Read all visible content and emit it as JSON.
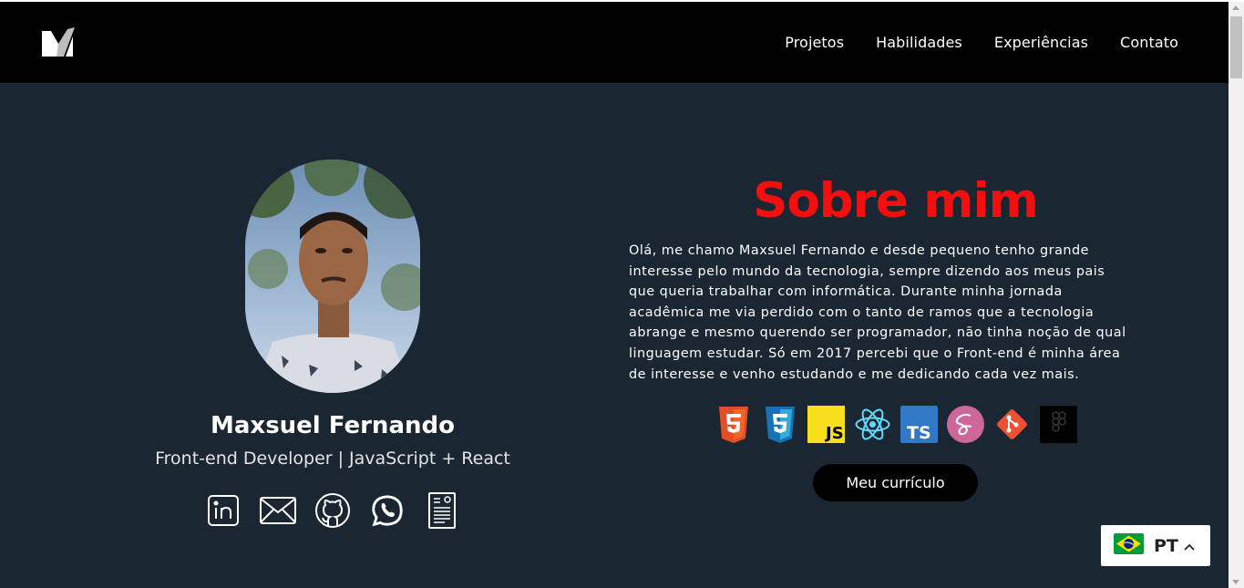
{
  "nav": {
    "links": [
      {
        "label": "Projetos"
      },
      {
        "label": "Habilidades"
      },
      {
        "label": "Experiências"
      },
      {
        "label": "Contato"
      }
    ]
  },
  "profile": {
    "name": "Maxsuel Fernando",
    "role": "Front-end Developer | JavaScript + React",
    "social_icons": [
      "linkedin-icon",
      "mail-icon",
      "github-icon",
      "whatsapp-icon",
      "resume-icon"
    ]
  },
  "about": {
    "title": "Sobre mim",
    "lines": [
      "Olá, me chamo Maxsuel Fernando e desde pequeno tenho grande",
      "interesse pelo mundo da tecnologia, sempre dizendo aos meus pais",
      "que queria trabalhar com informática. Durante minha jornada",
      "acadêmica me via perdido com o tanto de ramos que a tecnologia",
      "abrange e mesmo querendo ser programador, não tinha noção de qual",
      "linguagem estudar. Só em 2017 percebi que o Front-end é minha área",
      "de interesse e venho estudando e me dedicando cada vez mais."
    ],
    "tech_icons": [
      "html5-icon",
      "css3-icon",
      "javascript-icon",
      "react-icon",
      "typescript-icon",
      "sass-icon",
      "git-icon",
      "figma-icon"
    ],
    "cv_button": "Meu currículo"
  },
  "language": {
    "label": "PT",
    "flag": "brazil-flag-icon"
  },
  "colors": {
    "background": "#1b2633",
    "navbar": "#000000",
    "accent": "#f20f0f"
  }
}
